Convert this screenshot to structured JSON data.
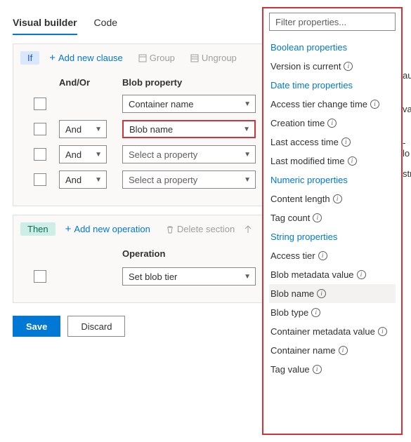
{
  "tabs": {
    "visual": "Visual builder",
    "code": "Code"
  },
  "if": {
    "label": "If",
    "add": "Add new clause",
    "group": "Group",
    "ungroup": "Ungroup",
    "headers": {
      "andor": "And/Or",
      "prop": "Blob property"
    },
    "rows": [
      {
        "andor": "",
        "prop": "Container name",
        "placeholder": false
      },
      {
        "andor": "And",
        "prop": "Blob name",
        "placeholder": false,
        "highlight": true
      },
      {
        "andor": "And",
        "prop": "Select a property",
        "placeholder": true
      },
      {
        "andor": "And",
        "prop": "Select a property",
        "placeholder": true
      }
    ]
  },
  "then": {
    "label": "Then",
    "add": "Add new operation",
    "delete": "Delete section",
    "opHeader": "Operation",
    "row": {
      "op": "Set blob tier"
    }
  },
  "footer": {
    "save": "Save",
    "discard": "Discard"
  },
  "panel": {
    "filterPlaceholder": "Filter properties...",
    "groups": [
      {
        "label": "Boolean properties",
        "items": [
          "Version is current"
        ]
      },
      {
        "label": "Date time properties",
        "items": [
          "Access tier change time",
          "Creation time",
          "Last access time",
          "Last modified time"
        ]
      },
      {
        "label": "Numeric properties",
        "items": [
          "Content length",
          "Tag count"
        ]
      },
      {
        "label": "String properties",
        "items": [
          "Access tier",
          "Blob metadata value",
          "Blob name",
          "Blob type",
          "Container metadata value",
          "Container name",
          "Tag value"
        ]
      }
    ],
    "selected": "Blob name"
  },
  "clipped": {
    "v1": "au",
    "v2": "va",
    "v3": "-lo",
    "v4": "stri"
  }
}
